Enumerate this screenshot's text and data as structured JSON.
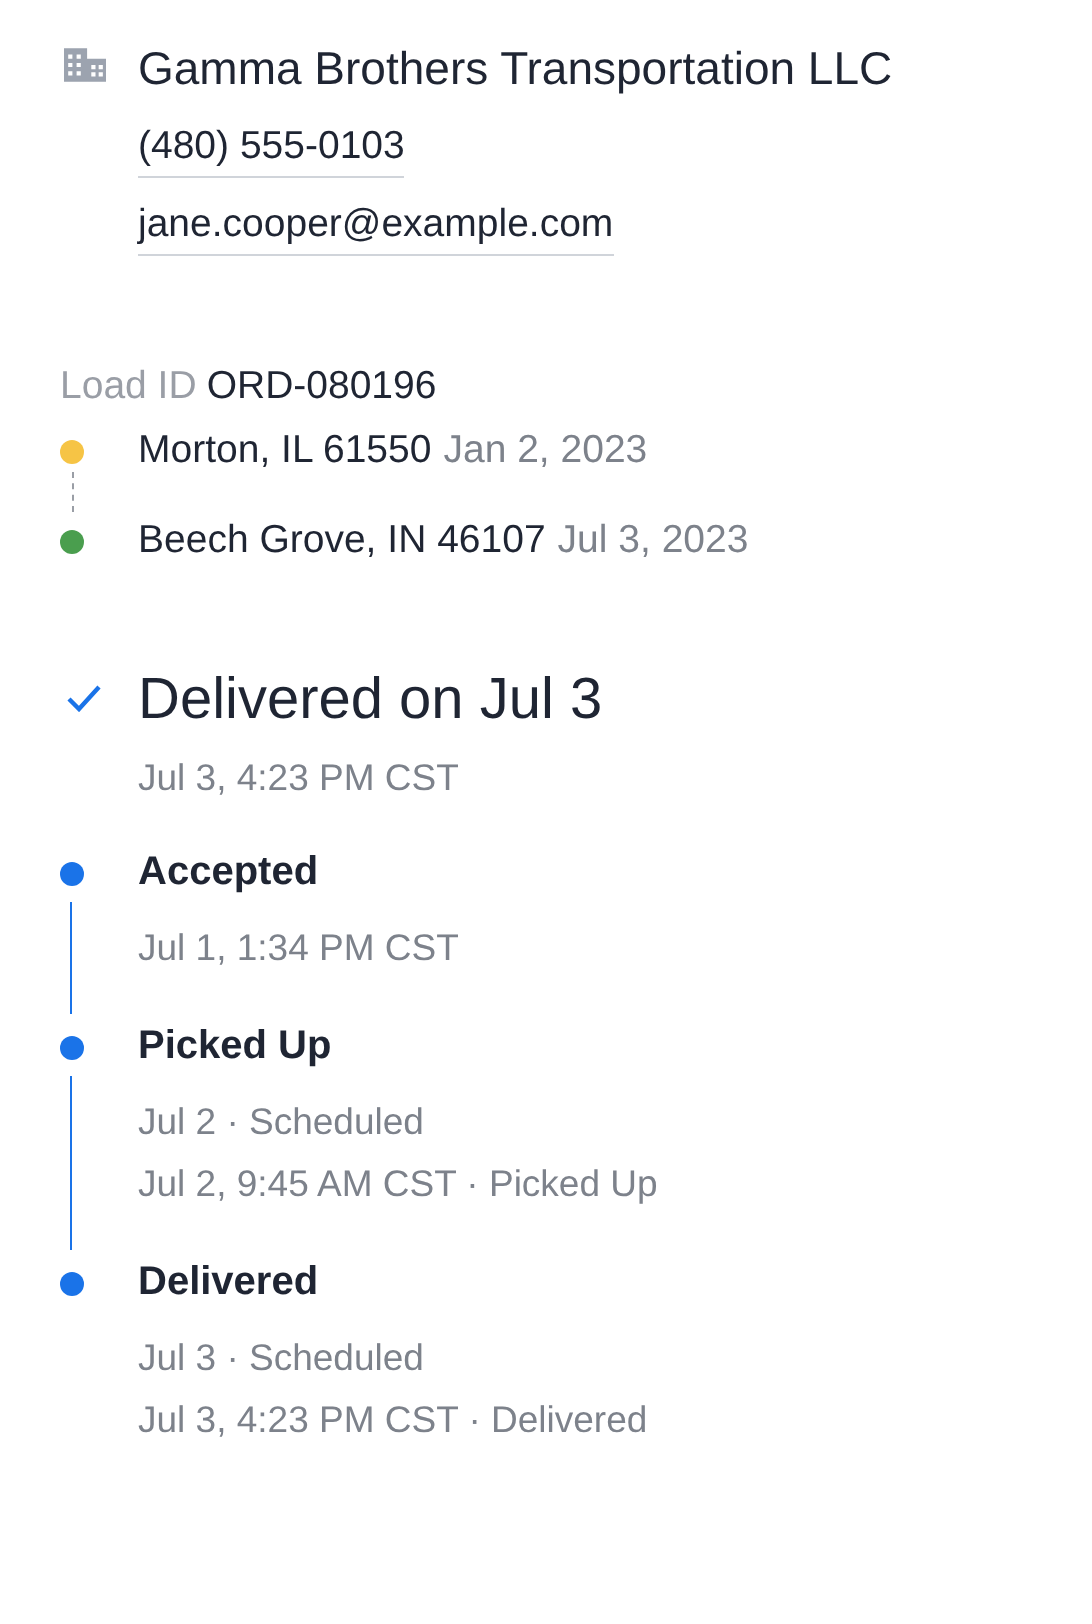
{
  "company": {
    "name": "Gamma Brothers Transportation LLC",
    "phone": "(480) 555-0103",
    "email": "jane.cooper@example.com"
  },
  "load": {
    "label": "Load ID",
    "id": "ORD-080196"
  },
  "stops": [
    {
      "place": "Morton, IL 61550",
      "date": "Jan 2, 2023",
      "color": "#f6c445"
    },
    {
      "place": "Beech Grove, IN 46107",
      "date": "Jul 3, 2023",
      "color": "#4a9e4e"
    }
  ],
  "status": {
    "title": "Delivered on Jul 3",
    "time": "Jul 3, 4:23 PM CST"
  },
  "events": [
    {
      "title": "Accepted",
      "lines": [
        "Jul 1, 1:34 PM CST"
      ]
    },
    {
      "title": "Picked Up",
      "lines": [
        "Jul 2 · Scheduled",
        "Jul 2, 9:45 AM CST · Picked Up"
      ]
    },
    {
      "title": "Delivered",
      "lines": [
        "Jul 3 · Scheduled",
        "Jul 3, 4:23 PM CST · Delivered"
      ]
    }
  ]
}
